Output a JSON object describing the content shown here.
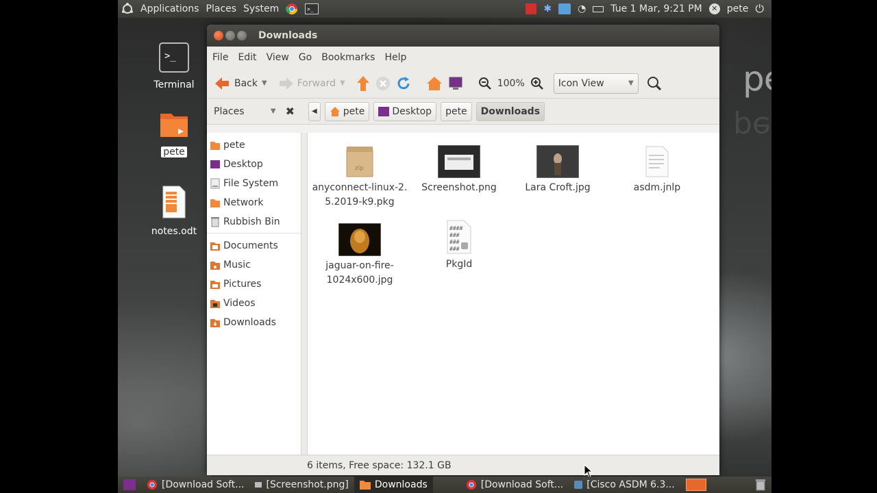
{
  "top_panel": {
    "menus": [
      "Applications",
      "Places",
      "System"
    ],
    "clock": "Tue 1 Mar,  9:21 PM",
    "user": "pete"
  },
  "desktop": {
    "icons": [
      {
        "label": "Terminal",
        "icon": "terminal-icon"
      },
      {
        "label": "pete",
        "icon": "home-folder-icon"
      },
      {
        "label": "notes.odt",
        "icon": "document-icon"
      }
    ],
    "watermark": "petenetlive"
  },
  "window": {
    "title": "Downloads",
    "menu": [
      "File",
      "Edit",
      "View",
      "Go",
      "Bookmarks",
      "Help"
    ],
    "toolbar": {
      "back": "Back",
      "forward": "Forward",
      "zoom": "100%",
      "view_mode": "Icon View"
    },
    "places_label": "Places",
    "breadcrumbs": [
      "pete",
      "Desktop",
      "pete",
      "Downloads"
    ],
    "sidebar": {
      "group1": [
        "pete",
        "Desktop",
        "File System",
        "Network",
        "Rubbish Bin"
      ],
      "group2": [
        "Documents",
        "Music",
        "Pictures",
        "Videos",
        "Downloads"
      ]
    },
    "files": [
      {
        "name_line1": "anyconnect-linux-2.",
        "name_line2": "5.2019-k9.pkg",
        "icon": "zip-package-icon"
      },
      {
        "name_line1": "Screenshot.png",
        "name_line2": "",
        "icon": "image-thumbnail"
      },
      {
        "name_line1": "Lara Croft.jpg",
        "name_line2": "",
        "icon": "image-thumbnail"
      },
      {
        "name_line1": "asdm.jnlp",
        "name_line2": "",
        "icon": "text-file-icon"
      },
      {
        "name_line1": "jaguar-on-fire-",
        "name_line2": "1024x600.jpg",
        "icon": "image-thumbnail"
      },
      {
        "name_line1": "PkgId",
        "name_line2": "",
        "icon": "locked-file-icon"
      }
    ],
    "status": "6 items, Free space: 132.1 GB"
  },
  "taskbar": {
    "tasks": [
      "[Download Soft...",
      "[Screenshot.png]",
      "Downloads",
      "[Download Soft...",
      "[Cisco ASDM 6.3..."
    ]
  }
}
